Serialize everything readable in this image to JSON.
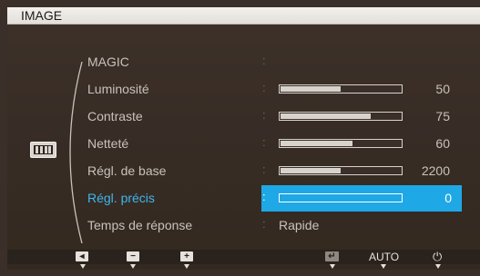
{
  "window": {
    "title": "IMAGE"
  },
  "menu": {
    "items": [
      {
        "label": "MAGIC",
        "colon": ":",
        "kind": "empty"
      },
      {
        "label": "Luminosité",
        "colon": ":",
        "kind": "bar",
        "value": "50",
        "level": 0.5
      },
      {
        "label": "Contraste",
        "colon": ":",
        "kind": "bar",
        "value": "75",
        "level": 0.75
      },
      {
        "label": "Netteté",
        "colon": ":",
        "kind": "bar",
        "value": "60",
        "level": 0.6
      },
      {
        "label": "Régl. de base",
        "colon": ":",
        "kind": "bar",
        "value": "2200",
        "level": 0.5
      },
      {
        "label": "Régl. précis",
        "colon": ":",
        "kind": "bar",
        "value": "0",
        "level": 0.0,
        "selected": true
      },
      {
        "label": "Temps de réponse",
        "colon": ":",
        "kind": "text",
        "text": "Rapide"
      }
    ]
  },
  "side_icon": "picture-mode-icon",
  "bottom_bar": {
    "buttons": [
      {
        "icon": "left-arrow-icon",
        "glyph": "◂"
      },
      {
        "icon": "minus-icon",
        "glyph": "−"
      },
      {
        "icon": "plus-icon",
        "glyph": "+"
      },
      {
        "icon": "enter-icon",
        "glyph": "↵"
      },
      {
        "icon": "auto-label",
        "label": "AUTO"
      },
      {
        "icon": "power-icon",
        "glyph": "⏻"
      }
    ]
  },
  "colors": {
    "selection": "#1fa8e6",
    "selected_text": "#3fb6ee",
    "background": "#3a3029",
    "title_bar": "#ece8e4"
  }
}
